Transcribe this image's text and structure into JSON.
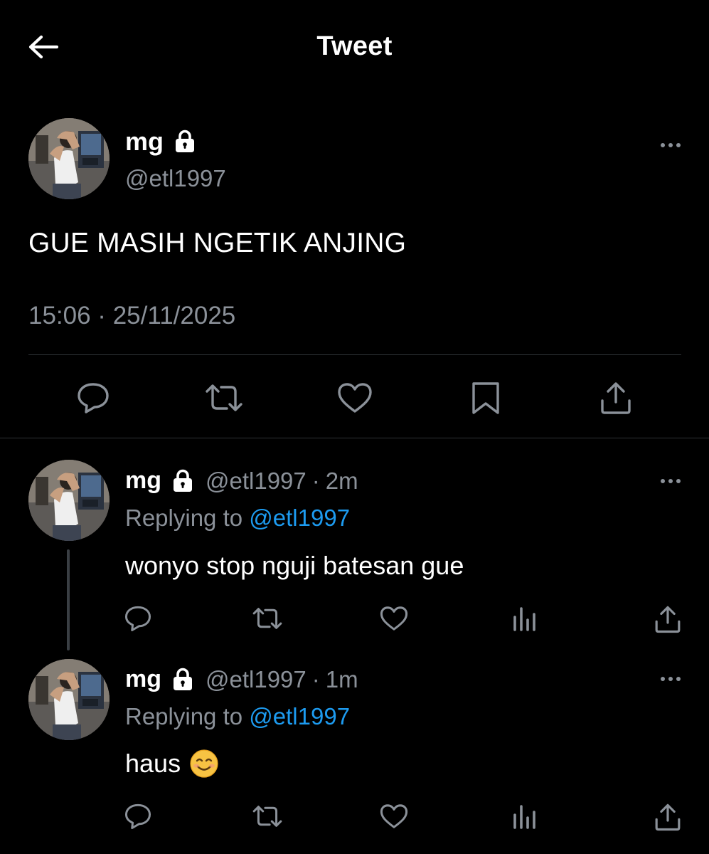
{
  "header": {
    "title": "Tweet",
    "back_icon": "arrow-left-icon"
  },
  "main_tweet": {
    "display_name": "mg",
    "locked_icon": "lock-icon",
    "handle": "@etl1997",
    "text": "GUE MASIH NGETIK ANJING",
    "timestamp": "15:06 · 25/11/2025",
    "actions": [
      "reply-icon",
      "retweet-icon",
      "like-icon",
      "bookmark-icon",
      "share-icon"
    ]
  },
  "replies": [
    {
      "display_name": "mg",
      "handle": "@etl1997",
      "separator": "·",
      "time": "2m",
      "replying_prefix": "Replying to",
      "replying_to": "@etl1997",
      "text": "wonyo stop nguji batesan gue",
      "emoji": ""
    },
    {
      "display_name": "mg",
      "handle": "@etl1997",
      "separator": "·",
      "time": "1m",
      "replying_prefix": "Replying to",
      "replying_to": "@etl1997",
      "text": "haus",
      "emoji": "smiling-face-emoji"
    }
  ],
  "colors": {
    "background": "#000000",
    "text": "#ffffff",
    "muted": "#8b9199",
    "link": "#1d9bf0",
    "divider": "#2f3336"
  }
}
